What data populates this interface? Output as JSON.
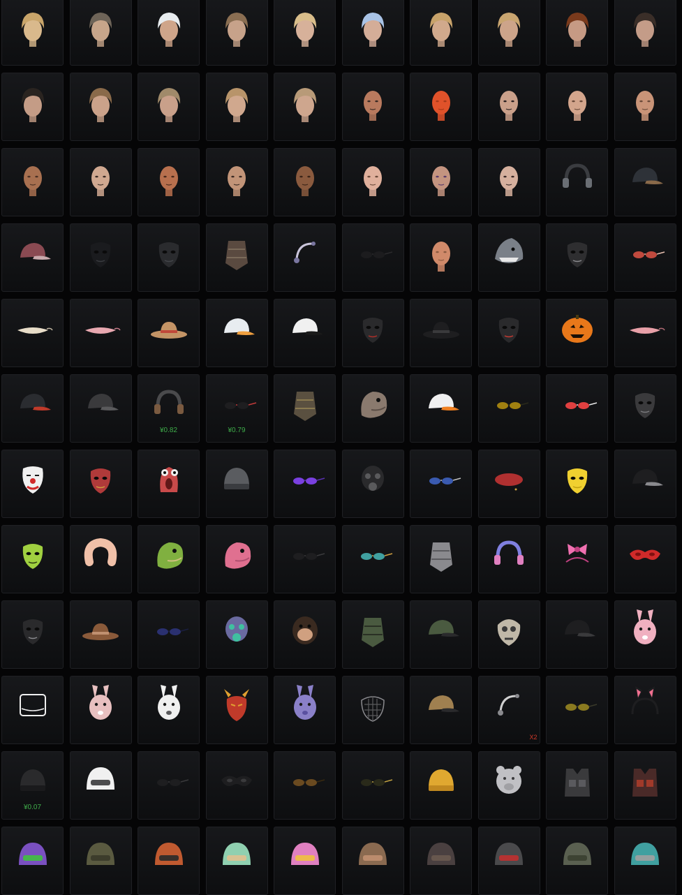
{
  "colors": {
    "background": "#050506",
    "tile": "#131417",
    "price": "#3fae4a",
    "quantity": "#d43a2a"
  },
  "items": [
    {
      "icon": "hair-short-blond-icon",
      "kind": "hair",
      "c1": "#c9a56a",
      "c2": "#d9b98c"
    },
    {
      "icon": "hair-mohawk-icon",
      "kind": "hair",
      "c1": "#6e6458",
      "c2": "#c7a58a"
    },
    {
      "icon": "hair-white-spiky-icon",
      "kind": "hair",
      "c1": "#e8ecef",
      "c2": "#cfa58a"
    },
    {
      "icon": "hair-curly-short-icon",
      "kind": "hair",
      "c1": "#8a6e52",
      "c2": "#c7a28a"
    },
    {
      "icon": "hair-ponytail-blond-icon",
      "kind": "hair",
      "c1": "#d9bd8a",
      "c2": "#d7b19a"
    },
    {
      "icon": "hair-blue-bob-icon",
      "kind": "hair",
      "c1": "#a9c3e6",
      "c2": "#d4ad98"
    },
    {
      "icon": "hair-long-blond-icon",
      "kind": "hair",
      "c1": "#c7a26a",
      "c2": "#d1a98c"
    },
    {
      "icon": "hair-short-blond-2-icon",
      "kind": "hair",
      "c1": "#c9a570",
      "c2": "#cda48a"
    },
    {
      "icon": "hair-braids-red-icon",
      "kind": "hair",
      "c1": "#7a3a1c",
      "c2": "#c69a84"
    },
    {
      "icon": "hair-bun-dark-icon",
      "kind": "hair",
      "c1": "#3a2e28",
      "c2": "#c49c88"
    },
    {
      "icon": "hair-dark-bob-icon",
      "kind": "hair",
      "c1": "#2a2420",
      "c2": "#c49c86"
    },
    {
      "icon": "hair-braid-brown-icon",
      "kind": "hair",
      "c1": "#8a6a4a",
      "c2": "#cba28a"
    },
    {
      "icon": "hair-bob-ash-icon",
      "kind": "hair",
      "c1": "#a08a6a",
      "c2": "#c9a08a"
    },
    {
      "icon": "hair-bob-blond-icon",
      "kind": "hair",
      "c1": "#b8946a",
      "c2": "#d0a88e"
    },
    {
      "icon": "hair-bob-light-icon",
      "kind": "hair",
      "c1": "#b89a78",
      "c2": "#cea68e"
    },
    {
      "icon": "face-bald-female-icon",
      "kind": "face",
      "c1": "#b97a5e",
      "c2": "#3a2a24"
    },
    {
      "icon": "face-orange-painted-icon",
      "kind": "face",
      "c1": "#e0522a",
      "c2": "#a83a1a"
    },
    {
      "icon": "face-female-makeup-icon",
      "kind": "face",
      "c1": "#caa08a",
      "c2": "#2a2020"
    },
    {
      "icon": "face-bald-male-icon",
      "kind": "face",
      "c1": "#d3a58c",
      "c2": "#6a4a3a"
    },
    {
      "icon": "face-bald-male-2-icon",
      "kind": "face",
      "c1": "#c99478",
      "c2": "#6a4a3a"
    },
    {
      "icon": "face-bald-male-3-icon",
      "kind": "face",
      "c1": "#a87050",
      "c2": "#4a3024"
    },
    {
      "icon": "face-female-pale-icon",
      "kind": "face",
      "c1": "#d0a890",
      "c2": "#3a2a24"
    },
    {
      "icon": "face-female-redhair-icon",
      "kind": "face",
      "c1": "#b8704e",
      "c2": "#4a2a1c"
    },
    {
      "icon": "face-female-dark-icon",
      "kind": "face",
      "c1": "#c29478",
      "c2": "#3a2a24"
    },
    {
      "icon": "face-female-tan-icon",
      "kind": "face",
      "c1": "#8a5a3e",
      "c2": "#3a2418"
    },
    {
      "icon": "face-female-light-icon",
      "kind": "face",
      "c1": "#e0b09c",
      "c2": "#6a4a3a"
    },
    {
      "icon": "face-female-purple-makeup-icon",
      "kind": "face",
      "c1": "#c49480",
      "c2": "#5a3a6a"
    },
    {
      "icon": "face-female-pale-2-icon",
      "kind": "face",
      "c1": "#d6b09e",
      "c2": "#3a2a28"
    },
    {
      "icon": "headphones-goggles-icon",
      "kind": "headset",
      "c1": "#3a3c40",
      "c2": "#6a6e74"
    },
    {
      "icon": "aviator-cap-goggles-icon",
      "kind": "cap",
      "c1": "#2e3238",
      "c2": "#8a6a4a"
    },
    {
      "icon": "baseball-cap-maroon-icon",
      "kind": "cap",
      "c1": "#8a4a52",
      "c2": "#c9a9ac"
    },
    {
      "icon": "black-mask-icon",
      "kind": "mask",
      "c1": "#1a1b1e",
      "c2": "#3a3c40"
    },
    {
      "icon": "face-mask-black-icon",
      "kind": "mask",
      "c1": "#2a2b2e",
      "c2": "#44464a"
    },
    {
      "icon": "bandage-wrap-icon",
      "kind": "wrap",
      "c1": "#5a4a40",
      "c2": "#7a6a5a"
    },
    {
      "icon": "earpiece-icon",
      "kind": "ear",
      "c1": "#c9c4da",
      "c2": "#7a76a0"
    },
    {
      "icon": "sunglasses-thin-icon",
      "kind": "glasses",
      "c1": "#1c1c1e",
      "c2": "#2a2a2c"
    },
    {
      "icon": "head-bun-mannequin-icon",
      "kind": "face",
      "c1": "#d08a6a",
      "c2": "#8a5a40"
    },
    {
      "icon": "shark-head-icon",
      "kind": "shark",
      "c1": "#7a8088",
      "c2": "#e8e8e8"
    },
    {
      "icon": "studded-mask-icon",
      "kind": "mask",
      "c1": "#2e2e30",
      "c2": "#8a8a8e"
    },
    {
      "icon": "round-glasses-red-icon",
      "kind": "glasses",
      "c1": "#c04a3e",
      "c2": "#e8c0b0"
    },
    {
      "icon": "cat-headband-icon",
      "kind": "band",
      "c1": "#e8ddc8",
      "c2": "#c0b4a0"
    },
    {
      "icon": "eye-mask-pink-icon",
      "kind": "band",
      "c1": "#e8a8b0",
      "c2": "#c47a88"
    },
    {
      "icon": "sun-hat-icon",
      "kind": "hat",
      "c1": "#c49466",
      "c2": "#c0483a"
    },
    {
      "icon": "baseball-cap-blue-icon",
      "kind": "cap",
      "c1": "#e8ecf0",
      "c2": "#f0a040"
    },
    {
      "icon": "captain-hat-icon",
      "kind": "cap",
      "c1": "#f0f0f0",
      "c2": "#1a1a1a"
    },
    {
      "icon": "tactical-mask-red-icon",
      "kind": "mask",
      "c1": "#2a2a2c",
      "c2": "#b0302a"
    },
    {
      "icon": "fedora-black-icon",
      "kind": "hat",
      "c1": "#1e1e20",
      "c2": "#3a3a3c"
    },
    {
      "icon": "red-visor-mask-icon",
      "kind": "mask",
      "c1": "#2a2a2c",
      "c2": "#c83a32"
    },
    {
      "icon": "pumpkin-head-icon",
      "kind": "pumpkin",
      "c1": "#e8781a",
      "c2": "#1a1006"
    },
    {
      "icon": "pink-eye-mask-icon",
      "kind": "band",
      "c1": "#e8a0a8",
      "c2": "#b06a74"
    },
    {
      "icon": "helmet-cap-red-star-icon",
      "kind": "cap",
      "c1": "#2a2c30",
      "c2": "#c03a2a"
    },
    {
      "icon": "cap-black-icon",
      "kind": "cap",
      "c1": "#3a3a3c",
      "c2": "#5a5a5c"
    },
    {
      "icon": "headphones-helmet-icon",
      "kind": "headset",
      "c1": "#4a4a4c",
      "c2": "#7a5a40",
      "price": "¥0.82"
    },
    {
      "icon": "visor-goggles-icon",
      "kind": "glasses",
      "c1": "#1e1e20",
      "c2": "#c03a3a",
      "price": "¥0.79"
    },
    {
      "icon": "camo-scarf-icon",
      "kind": "wrap",
      "c1": "#5a5040",
      "c2": "#8a7a50"
    },
    {
      "icon": "dinosaur-head-icon",
      "kind": "dino",
      "c1": "#8a7a6e",
      "c2": "#5a4e46"
    },
    {
      "icon": "mclaren-cap-icon",
      "kind": "cap",
      "c1": "#f0f0f0",
      "c2": "#f08020"
    },
    {
      "icon": "aviator-sunglasses-icon",
      "kind": "glasses",
      "c1": "#a08010",
      "c2": "#2a2a1a"
    },
    {
      "icon": "sport-sunglasses-icon",
      "kind": "glasses",
      "c1": "#e04040",
      "c2": "#e8e8e8"
    },
    {
      "icon": "hockey-mask-black-icon",
      "kind": "mask",
      "c1": "#3a3a3c",
      "c2": "#7a7a7e"
    },
    {
      "icon": "clown-mask-icon",
      "kind": "clown",
      "c1": "#f0f0f0",
      "c2": "#d02a2a"
    },
    {
      "icon": "luchador-mask-icon",
      "kind": "mask",
      "c1": "#b03a3a",
      "c2": "#d0a040"
    },
    {
      "icon": "worm-mask-icon",
      "kind": "worm",
      "c1": "#c84a4a",
      "c2": "#f0f0f0"
    },
    {
      "icon": "beanie-gray-icon",
      "kind": "beanie",
      "c1": "#5a5c60",
      "c2": "#3a3c40"
    },
    {
      "icon": "purple-sunglasses-icon",
      "kind": "glasses",
      "c1": "#7a40e0",
      "c2": "#5a30b0"
    },
    {
      "icon": "gas-mask-icon",
      "kind": "gasmask",
      "c1": "#2a2a2c",
      "c2": "#5a5a5c"
    },
    {
      "icon": "steampunk-goggles-icon",
      "kind": "glasses",
      "c1": "#3a5ab0",
      "c2": "#c0c0c0"
    },
    {
      "icon": "red-beret-icon",
      "kind": "beret",
      "c1": "#b03030",
      "c2": "#d0a040"
    },
    {
      "icon": "golden-mask-icon",
      "kind": "mask",
      "c1": "#f0d030",
      "c2": "#c0a010"
    },
    {
      "icon": "police-cap-icon",
      "kind": "cap",
      "c1": "#1e1e20",
      "c2": "#8a8a8e"
    },
    {
      "icon": "green-balaclava-icon",
      "kind": "mask",
      "c1": "#a0d040",
      "c2": "#2a3a10"
    },
    {
      "icon": "neck-pillow-icon",
      "kind": "pillow",
      "c1": "#f0c0a8",
      "c2": "#e0a088"
    },
    {
      "icon": "triceratops-hat-icon",
      "kind": "dino",
      "c1": "#80b040",
      "c2": "#d0c080"
    },
    {
      "icon": "pink-dino-head-icon",
      "kind": "dino",
      "c1": "#e07090",
      "c2": "#b05070"
    },
    {
      "icon": "thin-black-glasses-icon",
      "kind": "glasses",
      "c1": "#1e1e20",
      "c2": "#3a3a3c"
    },
    {
      "icon": "rainbow-goggles-icon",
      "kind": "glasses",
      "c1": "#40a0a0",
      "c2": "#d0a040"
    },
    {
      "icon": "gray-bandana-icon",
      "kind": "wrap",
      "c1": "#8a8a8e",
      "c2": "#5a5a5e"
    },
    {
      "icon": "purple-headset-mask-icon",
      "kind": "headset",
      "c1": "#8080e0",
      "c2": "#e080c0"
    },
    {
      "icon": "pink-bow-headband-icon",
      "kind": "bow",
      "c1": "#f070b0",
      "c2": "#c04080"
    },
    {
      "icon": "red-eye-mask-icon",
      "kind": "eyemask",
      "c1": "#d02a2a",
      "c2": "#801010"
    },
    {
      "icon": "black-face-mask-icon",
      "kind": "mask",
      "c1": "#2a2a2c",
      "c2": "#8a8a8e"
    },
    {
      "icon": "cowboy-hat-icon",
      "kind": "hat",
      "c1": "#8a5a3a",
      "c2": "#c09070"
    },
    {
      "icon": "blue-square-sunglasses-icon",
      "kind": "glasses",
      "c1": "#2a3070",
      "c2": "#1a1e40"
    },
    {
      "icon": "rainbow-gas-mask-icon",
      "kind": "gasmask",
      "c1": "#6a6aa0",
      "c2": "#40c0a0"
    },
    {
      "icon": "chimp-mask-icon",
      "kind": "chimp",
      "c1": "#3a2a20",
      "c2": "#d0a080"
    },
    {
      "icon": "green-face-cover-icon",
      "kind": "wrap",
      "c1": "#4a5a40",
      "c2": "#2a3024"
    },
    {
      "icon": "army-cap-headset-icon",
      "kind": "cap",
      "c1": "#4a5a40",
      "c2": "#2a2a2c"
    },
    {
      "icon": "skull-mask-icon",
      "kind": "skull",
      "c1": "#c0b8a8",
      "c2": "#3a3a3a"
    },
    {
      "icon": "black-cap-icon",
      "kind": "cap",
      "c1": "#1e1e20",
      "c2": "#3a3a3c"
    },
    {
      "icon": "bunny-ear-hat-icon",
      "kind": "bunny",
      "c1": "#f0b0c0",
      "c2": "#ffffff"
    },
    {
      "icon": "white-face-shield-icon",
      "kind": "shield",
      "c1": "#f0f0f0",
      "c2": "#2a2a2a"
    },
    {
      "icon": "bunny-mask-icon",
      "kind": "bunny",
      "c1": "#e8c0c0",
      "c2": "#ffffff"
    },
    {
      "icon": "bunny-gas-mask-icon",
      "kind": "bunny",
      "c1": "#f0f0f0",
      "c2": "#5a5a5c"
    },
    {
      "icon": "oni-mask-icon",
      "kind": "oni",
      "c1": "#c03a2a",
      "c2": "#e0a030"
    },
    {
      "icon": "purple-rabbit-mask-icon",
      "kind": "bunny",
      "c1": "#8a80c8",
      "c2": "#5a50a0"
    },
    {
      "icon": "muzzle-cage-icon",
      "kind": "muzzle",
      "c1": "#5a5a5c",
      "c2": "#8a8a8e"
    },
    {
      "icon": "gold-cap-headphones-icon",
      "kind": "cap",
      "c1": "#a08050",
      "c2": "#2a2a2c"
    },
    {
      "icon": "earphones-icon",
      "kind": "ear",
      "c1": "#d0d0d0",
      "c2": "#8a8a8e",
      "qty": "X2"
    },
    {
      "icon": "yellow-tint-glasses-icon",
      "kind": "glasses",
      "c1": "#8a7a20",
      "c2": "#3a3a2a"
    },
    {
      "icon": "bunny-ears-headband-icon",
      "kind": "earsband",
      "c1": "#1e1e20",
      "c2": "#f07090"
    },
    {
      "icon": "black-beanie-icon",
      "kind": "beanie",
      "c1": "#2a2a2c",
      "c2": "#1a1a1c",
      "price": "¥0.07"
    },
    {
      "icon": "white-helmet-icon",
      "kind": "helmet",
      "c1": "#f0f0f0",
      "c2": "#3a3a3c"
    },
    {
      "icon": "tactical-glasses-icon",
      "kind": "glasses",
      "c1": "#1e1e20",
      "c2": "#3a3a3c"
    },
    {
      "icon": "black-eye-mask-icon",
      "kind": "eyemask",
      "c1": "#1e1e20",
      "c2": "#3a3a3c"
    },
    {
      "icon": "brown-aviators-icon",
      "kind": "glasses",
      "c1": "#6a4a20",
      "c2": "#3a2a10"
    },
    {
      "icon": "gold-rim-glasses-icon",
      "kind": "glasses",
      "c1": "#2a2a1a",
      "c2": "#c0a040"
    },
    {
      "icon": "yellow-beanie-icon",
      "kind": "beanie",
      "c1": "#e0a830",
      "c2": "#c08820"
    },
    {
      "icon": "bear-mask-icon",
      "kind": "bear",
      "c1": "#c0c0c4",
      "c2": "#3a3a3c"
    },
    {
      "icon": "tactical-vest-black-icon",
      "kind": "vest",
      "c1": "#3a3a3c",
      "c2": "#5a5a5e"
    },
    {
      "icon": "tactical-vest-red-icon",
      "kind": "vest",
      "c1": "#4a2a28",
      "c2": "#a03a2a"
    },
    {
      "icon": "purple-robot-helmet-icon",
      "kind": "helmet",
      "c1": "#7a50c0",
      "c2": "#40c040"
    },
    {
      "icon": "camo-helmet-icon",
      "kind": "helmet",
      "c1": "#5a5a40",
      "c2": "#3a3a2a"
    },
    {
      "icon": "orange-camo-helmet-icon",
      "kind": "helmet",
      "c1": "#c05a30",
      "c2": "#2a2a2a"
    },
    {
      "icon": "mint-moto-helmet-icon",
      "kind": "helmet",
      "c1": "#90d0b0",
      "c2": "#e0c090"
    },
    {
      "icon": "pink-unicorn-helmet-icon",
      "kind": "helmet",
      "c1": "#e080c0",
      "c2": "#f0c040"
    },
    {
      "icon": "antler-helmet-icon",
      "kind": "helmet",
      "c1": "#8a6a50",
      "c2": "#c09070"
    },
    {
      "icon": "plaid-helmet-icon",
      "kind": "helmet",
      "c1": "#4a4040",
      "c2": "#6a5a50"
    },
    {
      "icon": "red-visor-helmet-icon",
      "kind": "helmet",
      "c1": "#4a4a4c",
      "c2": "#c03030"
    },
    {
      "icon": "army-helmet-icon",
      "kind": "helmet",
      "c1": "#5a6050",
      "c2": "#3a4030"
    },
    {
      "icon": "teal-camo-helmet-icon",
      "kind": "helmet",
      "c1": "#40a0a0",
      "c2": "#a0a0a0"
    }
  ]
}
